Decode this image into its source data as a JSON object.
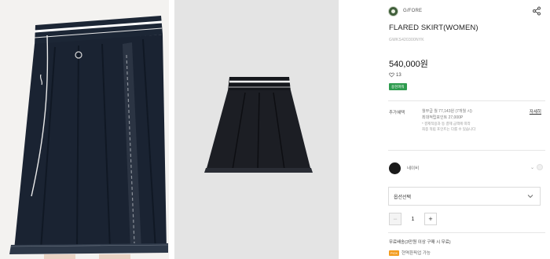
{
  "brand": {
    "name": "G/FORE"
  },
  "product": {
    "title": "FLARED SKIRT(WOMEN)",
    "code": "GWKS420300NYK",
    "price": "540,000원",
    "likes": "13",
    "badge": "용현파워"
  },
  "benefits": {
    "label": "추가혜택",
    "lines": [
      "월무급 월 77,143원 (7개월 시)",
      "최대적립포인트 27,000P",
      "* 결제적용과 등 결제 금액에 따라",
      "최종 적립 포인트는 다를 수 있습니다"
    ],
    "detail_link": "자세히"
  },
  "color": {
    "name": "네이비",
    "swatch": "#1a1a1a"
  },
  "option_select": {
    "placeholder": "옵션선택"
  },
  "quantity": {
    "value": "1",
    "minus": "−",
    "plus": "+"
  },
  "shipping": {
    "text": "무료배송(3만원 이상 구매 시 무료)"
  },
  "pickup": {
    "icon_label": "PICK",
    "text": "현역환픽업 가능"
  },
  "colors": {
    "accent_green": "#2e9b4e",
    "navy": "#1b2a3a"
  }
}
